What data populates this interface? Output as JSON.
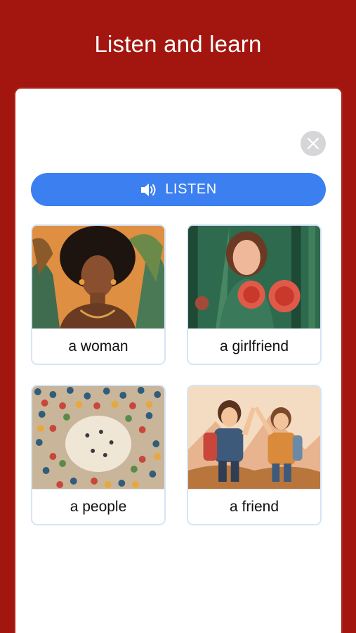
{
  "header": {
    "title": "Listen and learn"
  },
  "controls": {
    "close_icon": "close-icon",
    "listen_label": "LISTEN",
    "listen_icon": "speaker-icon"
  },
  "options": [
    {
      "label": "a woman",
      "image": "portrait of a woman with curly hair among leaves"
    },
    {
      "label": "a girlfriend",
      "image": "girl holding red roses in a forest"
    },
    {
      "label": "a people",
      "image": "large crowd of people seen from above"
    },
    {
      "label": "a friend",
      "image": "two friends giving a high five"
    }
  ],
  "colors": {
    "background": "#a3160f",
    "accent": "#3b7ff0",
    "card": "#ffffff"
  }
}
